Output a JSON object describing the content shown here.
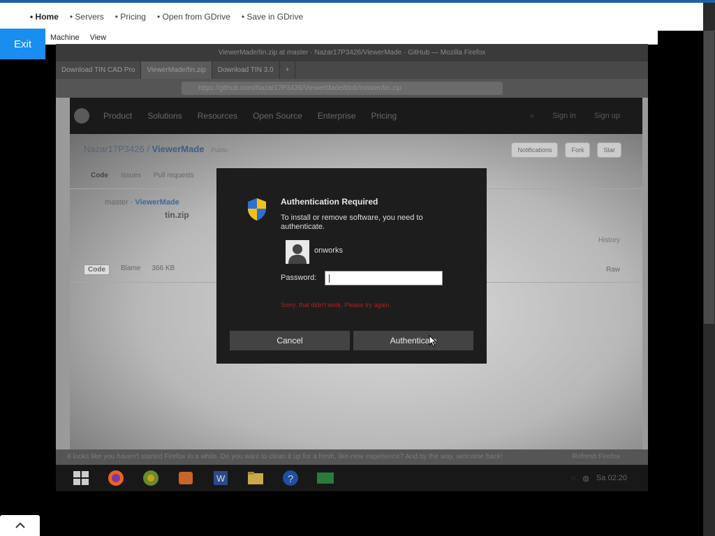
{
  "topnav": {
    "items": [
      "• Home",
      "• Servers",
      "• Pricing",
      "• Open from GDrive",
      "• Save in GDrive"
    ]
  },
  "exit_label": "Exit",
  "vm_menu": [
    "Machine",
    "View"
  ],
  "browser": {
    "title": "ViewerMade/tin.zip at master · Nazar17P3426/ViewerMade · GitHub — Mozilla Firefox",
    "tabs": [
      "Download TIN CAD Pro",
      "ViewerMade/tin.zip",
      "Download TIN 3.0"
    ],
    "url": "https://github.com/Nazar17P3426/ViewerMade/blob/master/tin.zip"
  },
  "github": {
    "nav": [
      "Product",
      "Solutions",
      "Resources",
      "Open Source",
      "Enterprise",
      "Pricing"
    ],
    "signin": "Sign in",
    "signup": "Sign up",
    "repo_owner": "Nazar17P3426",
    "repo_sep": " / ",
    "repo_name": "ViewerMade",
    "repo_badge": "Public",
    "notifications": "Notifications",
    "fork": "Fork",
    "star": "Star",
    "tabs": [
      "Code",
      "Issues",
      "Pull requests"
    ],
    "branch": "master",
    "breadcrumb_repo": "ViewerMade",
    "file_name": "tin.zip",
    "history": "History",
    "code_tabs": [
      "Code",
      "Blame"
    ],
    "file_size": "366 KB",
    "raw": "Raw"
  },
  "notification_bar": "It looks like you haven't started Firefox in a while. Do you want to clean it up for a fresh, like-new experience? And by the way, welcome back!",
  "notification_action": "Refresh Firefox",
  "taskbar": {
    "clock": "Sa 02:20"
  },
  "dialog": {
    "title": "Authentication Required",
    "message": "To install or remove software, you need to authenticate.",
    "username": "onworks",
    "password_label": "Password:",
    "error": "Sorry, that didn't work. Please try again.",
    "cancel": "Cancel",
    "authenticate": "Authenticate"
  },
  "colors": {
    "accent": "#1a8df0",
    "dialog_bg": "#1d1d1d",
    "error": "#b02020"
  }
}
